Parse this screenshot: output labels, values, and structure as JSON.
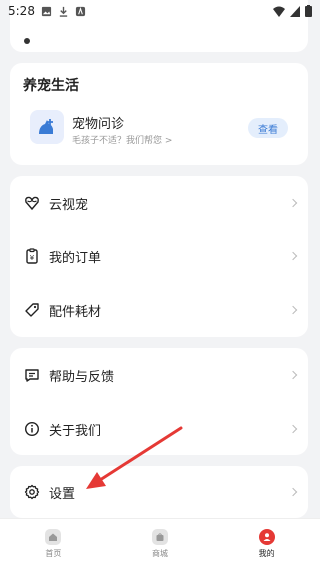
{
  "status_bar": {
    "time": "5:28"
  },
  "life_section": {
    "title": "养宠生活",
    "item": {
      "name": "宠物问诊",
      "subtitle": "毛孩子不适？我们帮您 >",
      "button": "查看"
    }
  },
  "menu_group_1": [
    {
      "label": "云视宠",
      "icon": "heart-icon"
    },
    {
      "label": "我的订单",
      "icon": "order-icon"
    },
    {
      "label": "配件耗材",
      "icon": "tag-icon"
    }
  ],
  "menu_group_2": [
    {
      "label": "帮助与反馈",
      "icon": "feedback-icon"
    },
    {
      "label": "关于我们",
      "icon": "info-icon"
    }
  ],
  "menu_group_3": [
    {
      "label": "设置",
      "icon": "gear-icon"
    }
  ],
  "tabbar": [
    {
      "label": "首页",
      "icon": "home-icon",
      "active": false
    },
    {
      "label": "商城",
      "icon": "shop-icon",
      "active": false
    },
    {
      "label": "我的",
      "icon": "user-icon",
      "active": true
    }
  ],
  "colors": {
    "accent": "#3a7bd5",
    "arrow": "#e53935",
    "active_tab": "#e53935"
  }
}
